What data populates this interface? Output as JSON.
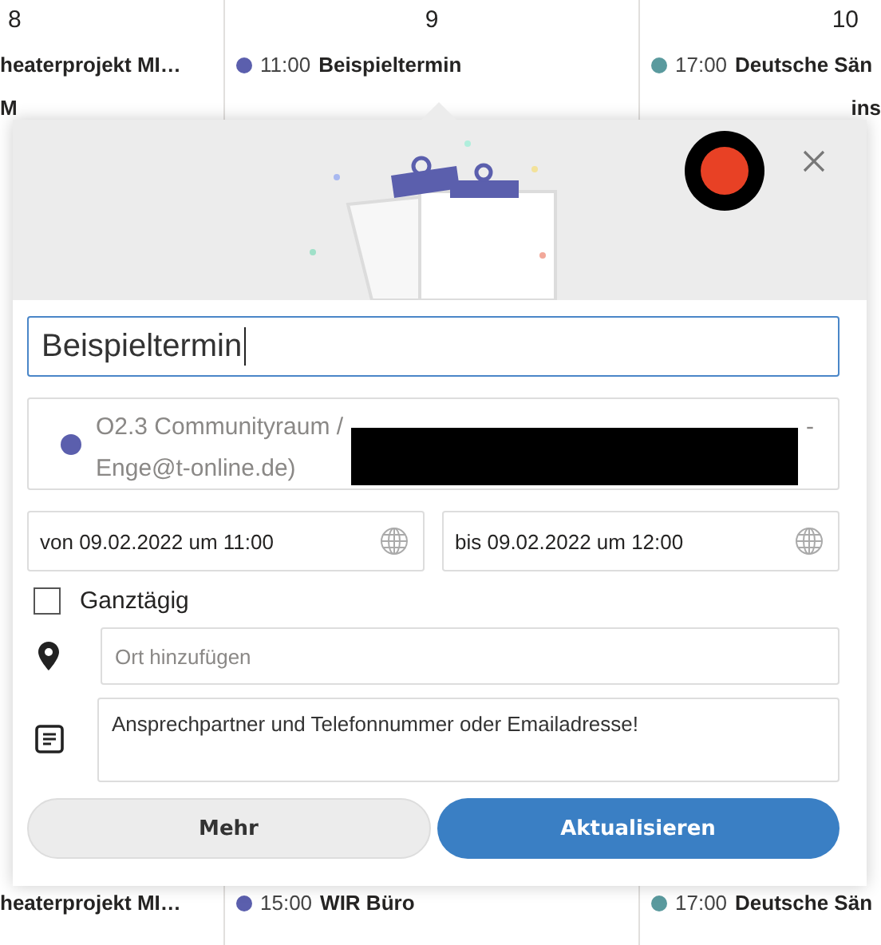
{
  "calendar": {
    "days": [
      {
        "number": "8",
        "events": [
          {
            "title": "heaterprojekt MI…"
          },
          {
            "title": "M"
          }
        ],
        "bottom_events": [
          {
            "title": "heaterprojekt MI…"
          }
        ]
      },
      {
        "number": "9",
        "events": [
          {
            "time": "11:00",
            "title": "Beispieltermin",
            "color": "#5b5fad"
          }
        ],
        "bottom_events": [
          {
            "time": "15:00",
            "title": "WIR Büro",
            "color": "#5b5fad"
          }
        ]
      },
      {
        "number": "10",
        "events": [
          {
            "time": "17:00",
            "title": "Deutsche Sän",
            "color": "#5a9a9e"
          },
          {
            "title": "ins"
          }
        ],
        "bottom_events": [
          {
            "time": "17:00",
            "title": "Deutsche Sän",
            "color": "#5a9a9e"
          }
        ]
      }
    ]
  },
  "popup": {
    "title_value": "Beispieltermin",
    "calendar": {
      "line_1": "O2.3 Communityraum /",
      "line_1_end": "-",
      "line_2": "Enge@t-online.de)",
      "color": "#5b5fad",
      "redacted": true
    },
    "start": "von 09.02.2022 um 11:00",
    "end": "bis 09.02.2022 um 12:00",
    "all_day": {
      "label": "Ganztägig",
      "checked": false
    },
    "location": {
      "placeholder": "Ort hinzufügen"
    },
    "notes": "Ansprechpartner und Telefonnummer oder Emailadresse!",
    "buttons": [
      {
        "label": "Mehr",
        "kind": "secondary"
      },
      {
        "label": "Aktualisieren",
        "kind": "primary"
      }
    ]
  }
}
